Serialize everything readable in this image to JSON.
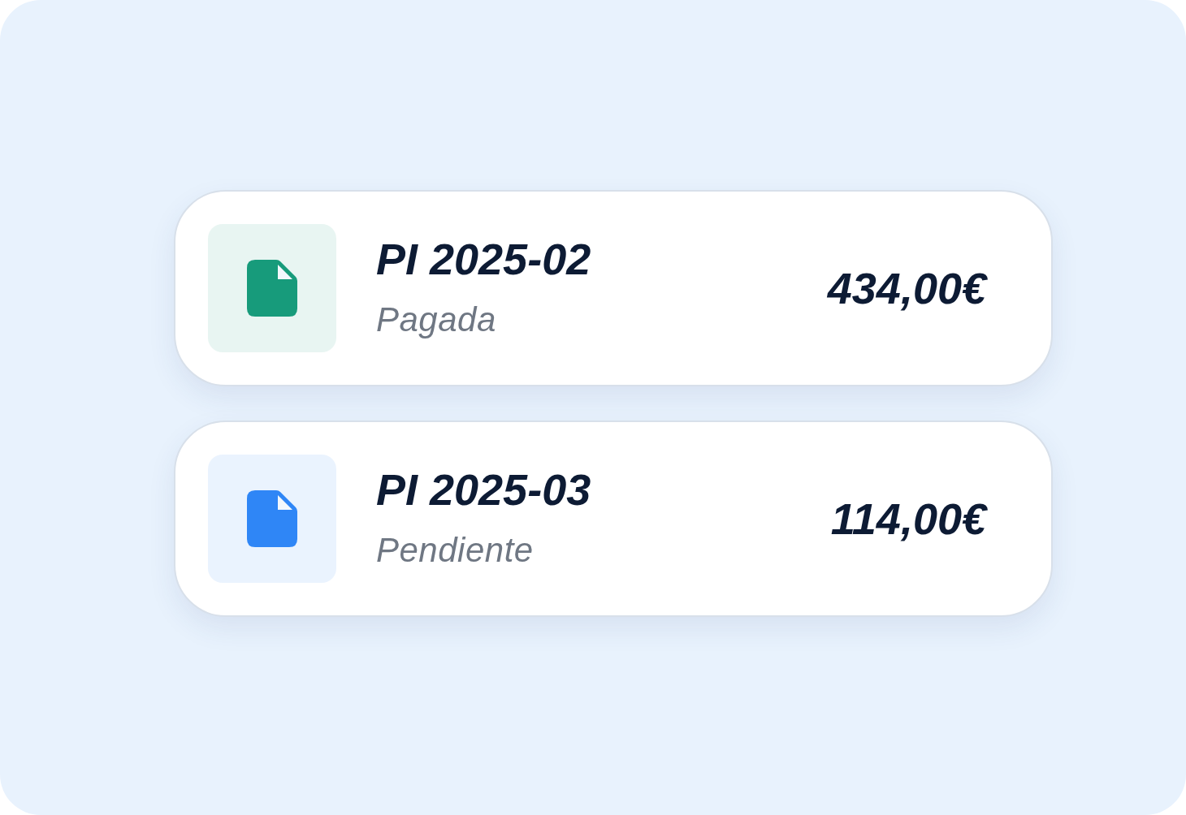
{
  "invoices": [
    {
      "number": "PI 2025-02",
      "status": "Pagada",
      "amount": "434,00€",
      "color": "#179b7b"
    },
    {
      "number": "PI 2025-03",
      "status": "Pendiente",
      "amount": "114,00€",
      "color": "#2f86f6"
    }
  ]
}
